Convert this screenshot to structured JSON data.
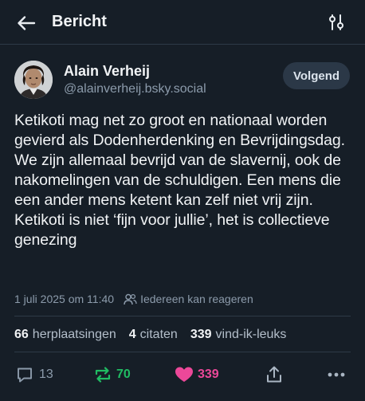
{
  "header": {
    "title": "Bericht"
  },
  "author": {
    "name": "Alain Verheij",
    "handle": "@alainverheij.bsky.social",
    "follow_label": "Volgend"
  },
  "post": {
    "text": "Ketikoti mag net zo groot en nationaal worden gevierd als Dodenherdenking en Bevrijdingsdag. We zijn allemaal bevrijd van de slavernij, ook de nakomelingen van de schuldigen. Een mens die een ander mens ketent kan zelf niet vrij zijn. Ketikoti is niet ‘fijn voor jullie’, het is collectieve genezing",
    "timestamp": "1 juli 2025 om 11:40",
    "reply_setting": "Iedereen kan reageren"
  },
  "stats": {
    "reposts_count": "66",
    "reposts_label": "herplaatsingen",
    "quotes_count": "4",
    "quotes_label": "citaten",
    "likes_count": "339",
    "likes_label": "vind-ik-leuks"
  },
  "actions": {
    "reply_count": "13",
    "repost_count": "70",
    "like_count": "339"
  },
  "colors": {
    "background": "#161e27",
    "repost_active": "#20bc63",
    "like_active": "#ec4899",
    "muted": "#8c9bab"
  }
}
